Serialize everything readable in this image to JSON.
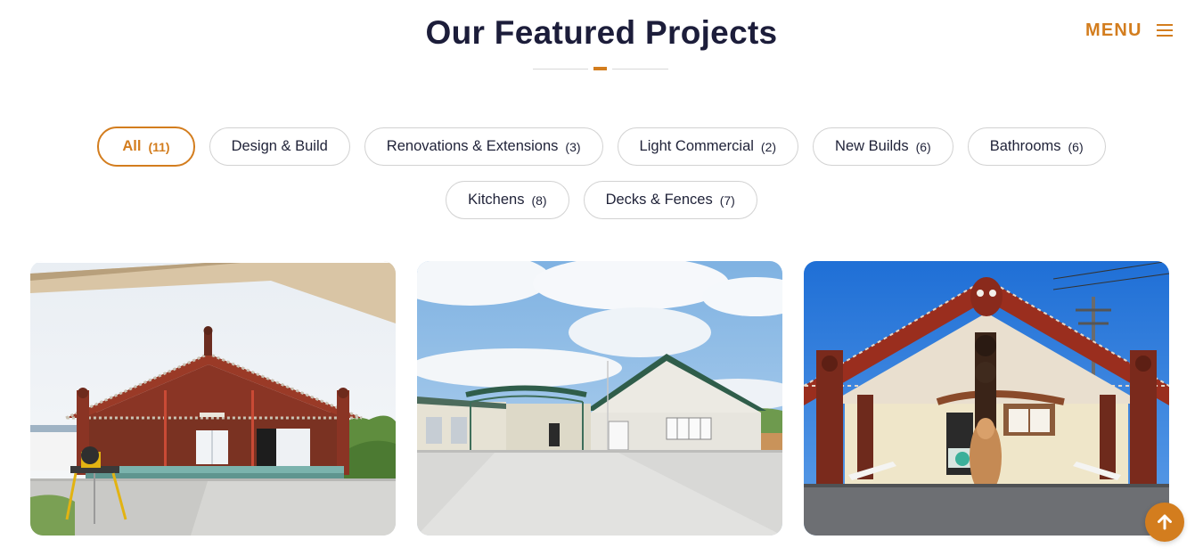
{
  "section": {
    "title": "Our Featured Projects"
  },
  "header": {
    "menu_label": "MENU",
    "menu_icon": "hamburger-icon"
  },
  "filters": {
    "row1": [
      {
        "label": "All",
        "count": "(11)",
        "active": true
      },
      {
        "label": "Design & Build",
        "count": "",
        "active": false
      },
      {
        "label": "Renovations & Extensions",
        "count": "(3)",
        "active": false
      },
      {
        "label": "Light Commercial",
        "count": "(2)",
        "active": false
      },
      {
        "label": "New Builds",
        "count": "(6)",
        "active": false
      },
      {
        "label": "Bathrooms",
        "count": "(6)",
        "active": false
      }
    ],
    "row2": [
      {
        "label": "Kitchens",
        "count": "(8)",
        "active": false
      },
      {
        "label": "Decks & Fences",
        "count": "(7)",
        "active": false
      }
    ]
  },
  "projects": [
    {
      "image": "wharenui-under-construction-photo"
    },
    {
      "image": "white-community-building-photo"
    },
    {
      "image": "carved-marae-entrance-photo"
    }
  ],
  "back_to_top": {
    "icon": "arrow-up-icon"
  },
  "colors": {
    "accent": "#d37d1e",
    "heading": "#1c1d3a",
    "pill_border": "#d2d2d2"
  }
}
